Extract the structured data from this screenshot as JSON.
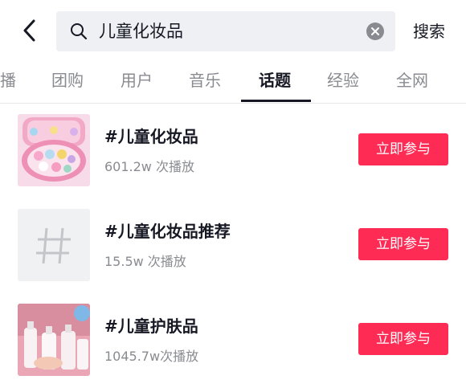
{
  "header": {
    "search_query": "儿童化妆品",
    "search_button": "搜索"
  },
  "tabs": [
    {
      "label": "播",
      "active": false
    },
    {
      "label": "团购",
      "active": false
    },
    {
      "label": "用户",
      "active": false
    },
    {
      "label": "音乐",
      "active": false
    },
    {
      "label": "话题",
      "active": true
    },
    {
      "label": "经验",
      "active": false
    },
    {
      "label": "全网",
      "active": false
    }
  ],
  "topics": [
    {
      "title": "#儿童化妆品",
      "plays": "601.2w 次播放",
      "button": "立即参与",
      "thumb": "makeup-palette"
    },
    {
      "title": "#儿童化妆品推荐",
      "plays": "15.5w 次播放",
      "button": "立即参与",
      "thumb": "hashtag-placeholder"
    },
    {
      "title": "#儿童护肤品",
      "plays": "1045.7w次播放",
      "button": "立即参与",
      "thumb": "skincare-bottles"
    }
  ],
  "colors": {
    "accent": "#fe2c55",
    "text_primary": "#161823",
    "text_secondary": "#8a8b91",
    "search_bg": "#eef0f3"
  }
}
